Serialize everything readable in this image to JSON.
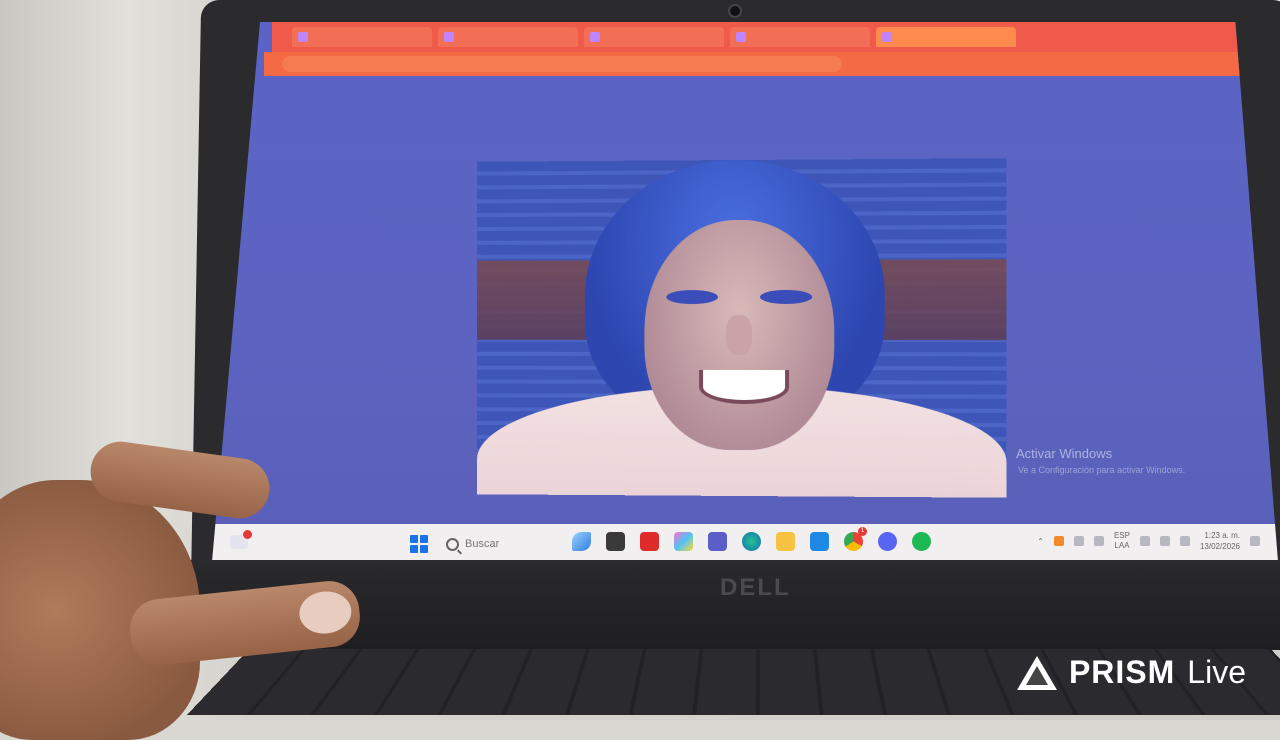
{
  "screen": {
    "watermark_title": "Activar Windows",
    "watermark_subtitle": "Ve a Configuración para activar Windows."
  },
  "taskbar": {
    "search_label": "Buscar",
    "lang_top": "ESP",
    "lang_bottom": "LAA",
    "time": "1:23 a. m.",
    "date": "13/02/2026",
    "chrome_badge": "1"
  },
  "laptop": {
    "brand_logo": "DELL"
  },
  "overlay": {
    "brand": "PRISM",
    "product": "Live"
  },
  "colors": {
    "browser_chrome": "#f05a4a",
    "screen_bg": "#5b64c6",
    "taskbar": "#f1efef"
  }
}
